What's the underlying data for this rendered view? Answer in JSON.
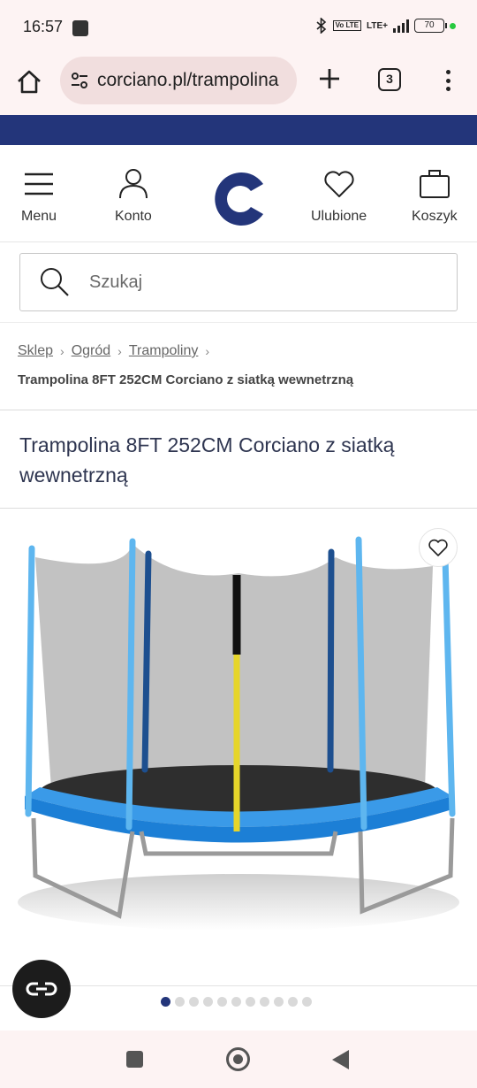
{
  "status_bar": {
    "time": "16:57",
    "network": "LTE+",
    "volte": "Vo LTE",
    "battery": "70"
  },
  "browser": {
    "url": "corciano.pl/trampolina",
    "tab_count": "3"
  },
  "header": {
    "menu_label": "Menu",
    "account_label": "Konto",
    "favorites_label": "Ulubione",
    "cart_label": "Koszyk",
    "brand_color": "#23357a"
  },
  "search": {
    "placeholder": "Szukaj"
  },
  "breadcrumb": {
    "items": [
      "Sklep",
      "Ogród",
      "Trampoliny"
    ],
    "current": "Trampolina 8FT 252CM Corciano z siatką wewnetrzną"
  },
  "product": {
    "title": "Trampolina 8FT 252CM Corciano z siatką wewnetrzną"
  },
  "gallery": {
    "image_count": 11,
    "active_index": 0
  },
  "chat": {
    "icon": "chat-link-icon"
  }
}
